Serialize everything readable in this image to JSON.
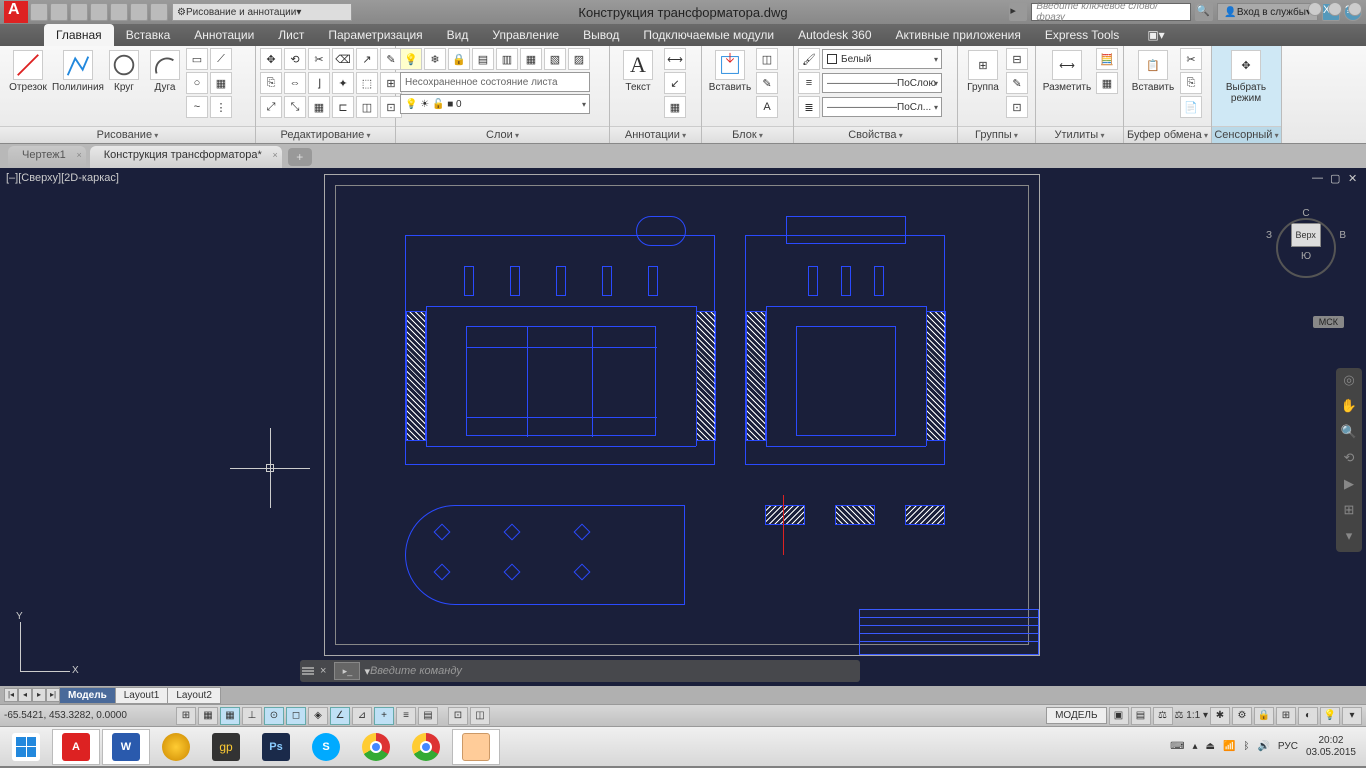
{
  "titlebar": {
    "app_letter": "A",
    "workspace_drop": "Рисование и аннотации",
    "title": "Конструкция трансформатора.dwg",
    "search_placeholder": "Введите ключевое слово/фразу",
    "login": "Вход в службы"
  },
  "ribbon_tabs": [
    "Главная",
    "Вставка",
    "Аннотации",
    "Лист",
    "Параметризация",
    "Вид",
    "Управление",
    "Вывод",
    "Подключаемые модули",
    "Autodesk 360",
    "Активные приложения",
    "Express Tools"
  ],
  "active_tab": 0,
  "panels": {
    "draw": {
      "title": "Рисование",
      "line": "Отрезок",
      "polyline": "Полилиния",
      "circle": "Круг",
      "arc": "Дуга"
    },
    "modify": {
      "title": "Редактирование"
    },
    "layers": {
      "title": "Слои",
      "state": "Несохраненное состояние листа"
    },
    "annotation": {
      "title": "Аннотации",
      "text": "Текст"
    },
    "block": {
      "title": "Блок",
      "insert": "Вставить"
    },
    "properties": {
      "title": "Свойства",
      "color": "Белый",
      "ltype": "———————ПоСлою",
      "lweight": "———————ПоСл..."
    },
    "groups": {
      "title": "Группы",
      "group": "Группа"
    },
    "utilities": {
      "title": "Утилиты",
      "measure": "Разметить"
    },
    "clipboard": {
      "title": "Буфер обмена",
      "paste": "Вставить"
    },
    "touch": {
      "title": "Сенсорный",
      "select": "Выбрать режим"
    }
  },
  "file_tabs": {
    "tab1": "Чертеж1",
    "tab2": "Конструкция трансформатора*"
  },
  "viewport": {
    "view_label": "[‒][Сверху][2D-каркас]",
    "viewcube_top": "С",
    "viewcube_left": "З",
    "viewcube_face": "Верх",
    "viewcube_right": "В",
    "viewcube_bottom": "Ю",
    "mck": "МСК",
    "ucs_x": "X",
    "ucs_y": "Y"
  },
  "cmdline": {
    "placeholder": "Введите команду"
  },
  "layout_tabs": {
    "model": "Модель",
    "l1": "Layout1",
    "l2": "Layout2"
  },
  "statusbar": {
    "coords": "-65.5421, 453.3282, 0.0000",
    "model_btn": "МОДЕЛЬ",
    "scale": "1:1",
    "lang": "РУС"
  },
  "taskbar": {
    "time": "20:02",
    "date": "03.05.2015",
    "lang": "РУС"
  }
}
